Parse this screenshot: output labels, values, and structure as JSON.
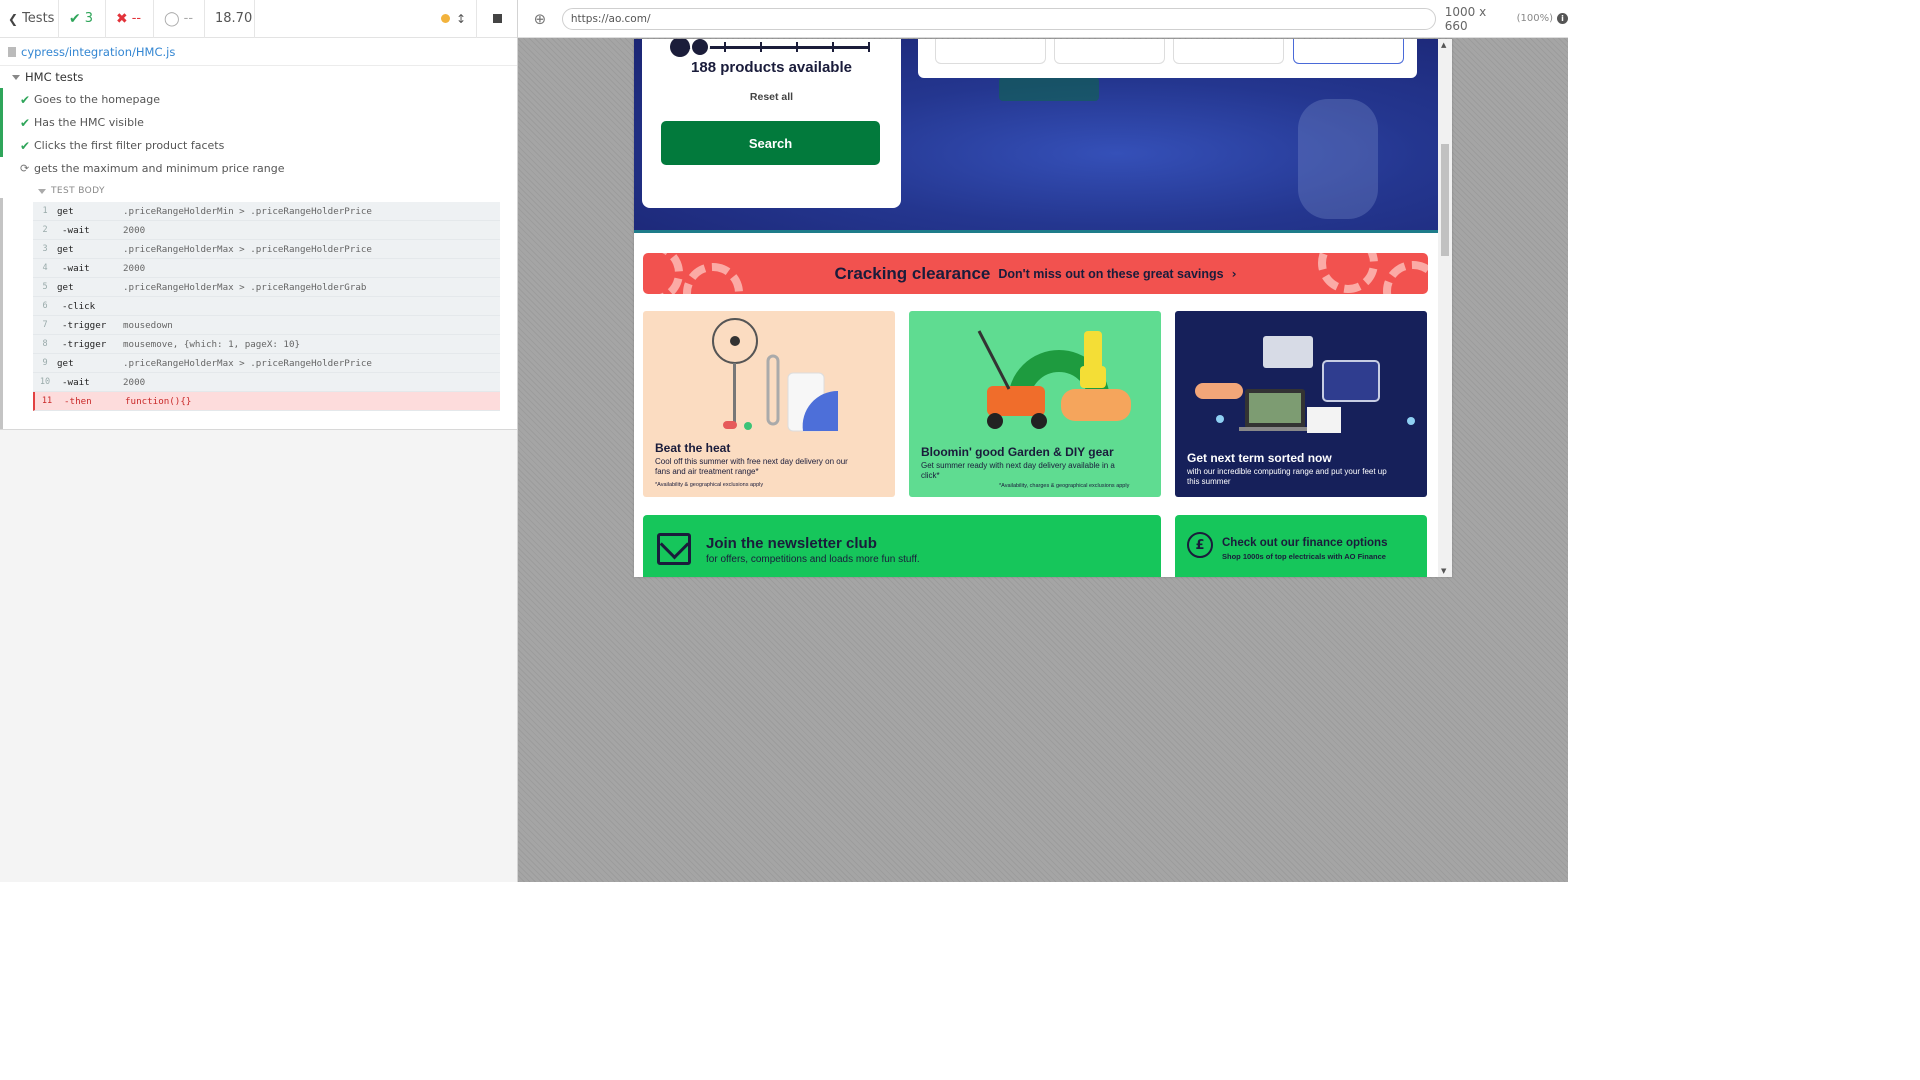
{
  "runner": {
    "header": {
      "tests_label": "Tests",
      "passed_count": "3",
      "failed_count": "--",
      "pending_count": "--",
      "duration": "18.70"
    },
    "spec_path": "cypress/integration/HMC.js",
    "suite_title": "HMC tests",
    "tests": [
      {
        "title": "Goes to the homepage",
        "state": "passed"
      },
      {
        "title": "Has the HMC visible",
        "state": "passed"
      },
      {
        "title": "Clicks the first filter product facets",
        "state": "passed"
      },
      {
        "title": "gets the maximum and minimum price range",
        "state": "running"
      }
    ],
    "test_body_label": "TEST BODY",
    "commands": [
      {
        "num": "1",
        "name": "get",
        "message": ".priceRangeHolderMin > .priceRangeHolderPrice",
        "child": false
      },
      {
        "num": "2",
        "name": "-wait",
        "message": "2000",
        "child": true
      },
      {
        "num": "3",
        "name": "get",
        "message": ".priceRangeHolderMax > .priceRangeHolderPrice",
        "child": false
      },
      {
        "num": "4",
        "name": "-wait",
        "message": "2000",
        "child": true
      },
      {
        "num": "5",
        "name": "get",
        "message": ".priceRangeHolderMax > .priceRangeHolderGrab",
        "child": false
      },
      {
        "num": "6",
        "name": "-click",
        "message": "",
        "child": true
      },
      {
        "num": "7",
        "name": "-trigger",
        "message": "mousedown",
        "child": true
      },
      {
        "num": "8",
        "name": "-trigger",
        "message": "mousemove, {which: 1, pageX: 10}",
        "child": true
      },
      {
        "num": "9",
        "name": "get",
        "message": ".priceRangeHolderMax > .priceRangeHolderPrice",
        "child": false
      },
      {
        "num": "10",
        "name": "-wait",
        "message": "2000",
        "child": true
      },
      {
        "num": "11",
        "name": "-then",
        "message": "function(){}",
        "child": true,
        "failed": true
      }
    ]
  },
  "aut": {
    "url": "https://ao.com/",
    "viewport_size": "1000 x 660",
    "viewport_scale": "(100%)",
    "site": {
      "products_available": "188 products available",
      "reset_all": "Reset all",
      "search_button": "Search",
      "clearance_title": "Cracking clearance",
      "clearance_subtitle": "Don't miss out on these great savings",
      "promos": [
        {
          "title": "Beat the heat",
          "text": "Cool off this summer with free next day delivery on our fans and air treatment range*",
          "small": "*Availability & geographical exclusions apply"
        },
        {
          "title": "Bloomin' good Garden & DIY gear",
          "text": "Get summer ready with next day delivery available in a click*",
          "small": "*Availability, charges & geographical exclusions apply"
        },
        {
          "title": "Get next term sorted now",
          "text": "with our incredible computing range and put your feet up this summer",
          "small": ""
        }
      ],
      "newsletter_title": "Join the newsletter club",
      "newsletter_sub": "for offers, competitions and loads more fun stuff.",
      "finance_title": "Check out our finance options",
      "finance_sub": "Shop 1000s of top electricals with AO Finance"
    }
  },
  "colors": {
    "pass": "#2fa55a",
    "fail": "#e2333a",
    "ao_green": "#027a3c",
    "clearance_red": "#f2524f",
    "navy": "#1a1c3b"
  }
}
